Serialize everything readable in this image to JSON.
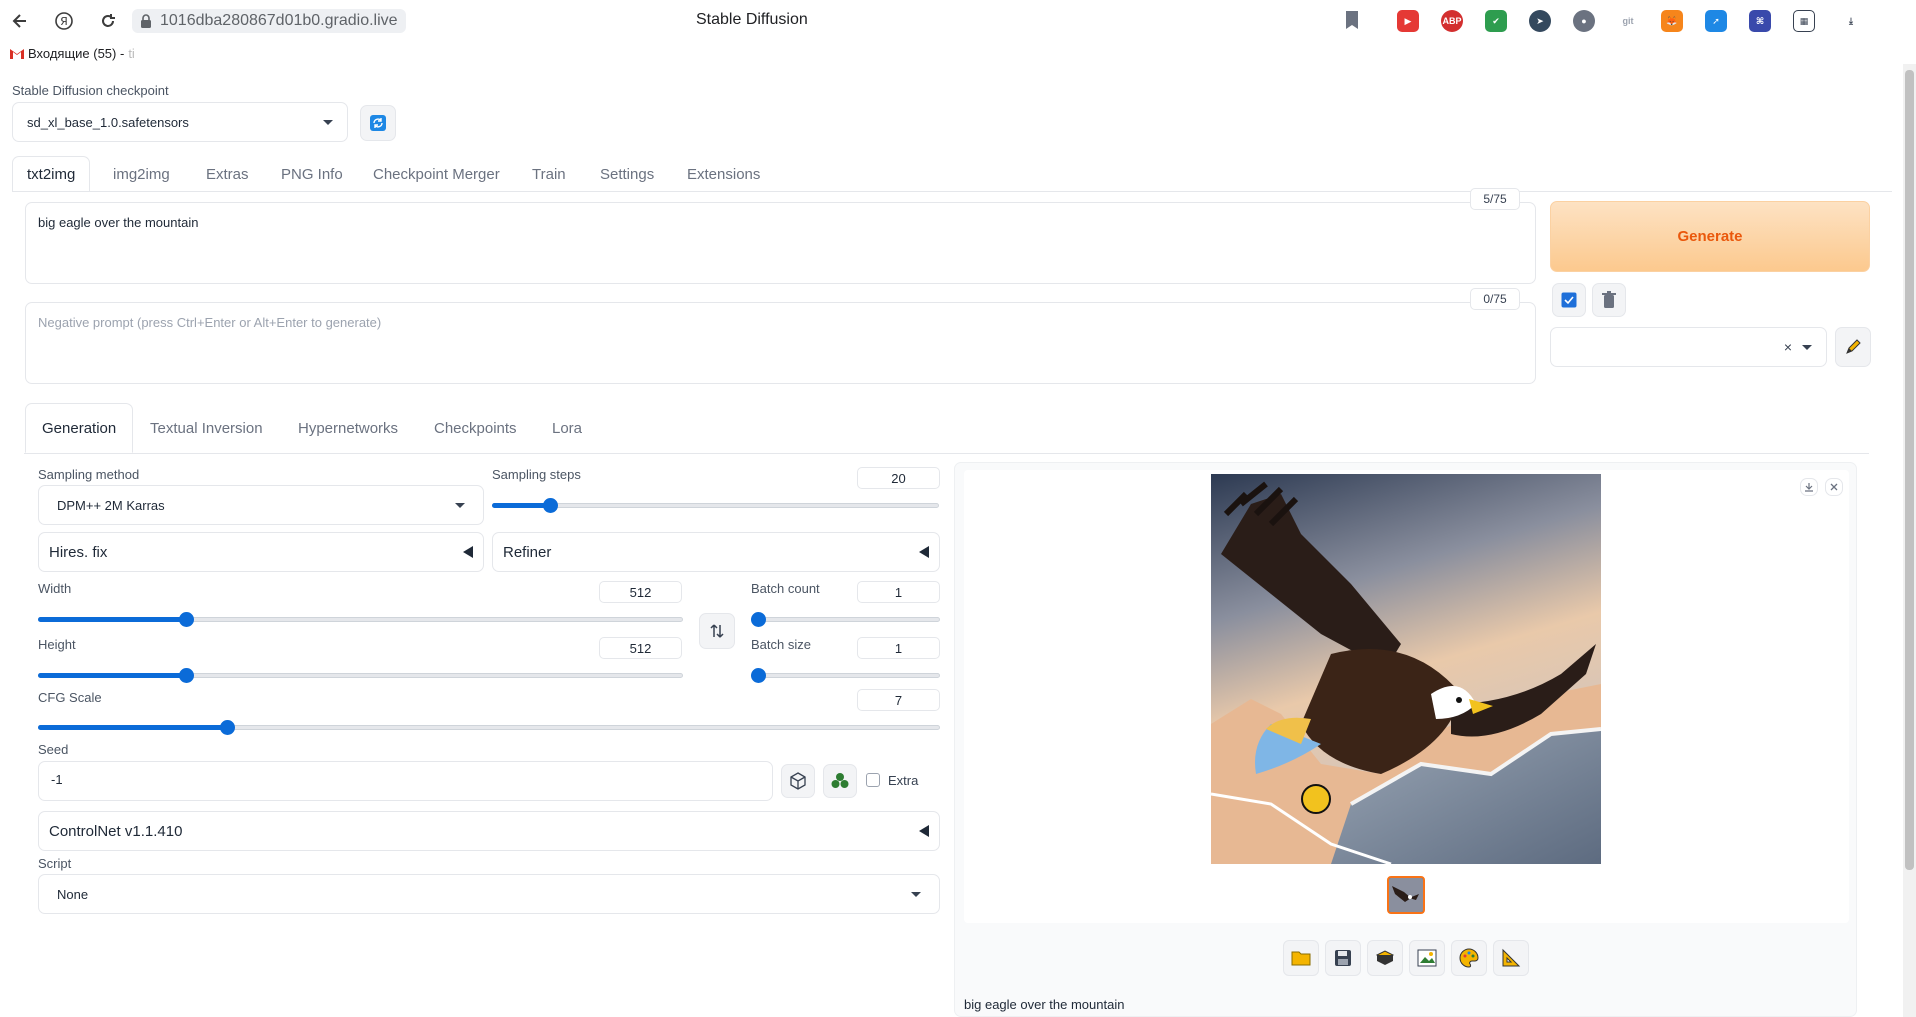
{
  "browser": {
    "url": "1016dba280867d01b0.gradio.live",
    "page_title": "Stable Diffusion",
    "bookmark": "Входящие (55) - ",
    "bookmark_tail": "ti",
    "extensions": [
      "youtube-icon",
      "abp-icon",
      "shield-icon",
      "cursor-icon",
      "planet-icon",
      "gitzip-icon",
      "metamask-icon",
      "send-icon",
      "scan-icon",
      "grid-icon",
      "download-icon"
    ]
  },
  "checkpoint": {
    "label": "Stable Diffusion checkpoint",
    "value": "sd_xl_base_1.0.safetensors"
  },
  "main_tabs": [
    "txt2img",
    "img2img",
    "Extras",
    "PNG Info",
    "Checkpoint Merger",
    "Train",
    "Settings",
    "Extensions"
  ],
  "prompt": {
    "value": "big eagle over the mountain",
    "token_count": "5/75"
  },
  "negative_prompt": {
    "placeholder": "Negative prompt (press Ctrl+Enter or Alt+Enter to generate)",
    "token_count": "0/75"
  },
  "generate_label": "Generate",
  "style_clear": "×",
  "sub_tabs": [
    "Generation",
    "Textual Inversion",
    "Hypernetworks",
    "Checkpoints",
    "Lora"
  ],
  "sampling": {
    "method_label": "Sampling method",
    "method_value": "DPM++ 2M Karras",
    "steps_label": "Sampling steps",
    "steps_value": "20",
    "steps_fraction": 0.13
  },
  "hires_label": "Hires. fix",
  "refiner_label": "Refiner",
  "width": {
    "label": "Width",
    "value": "512",
    "fraction": 0.23
  },
  "height": {
    "label": "Height",
    "value": "512",
    "fraction": 0.23
  },
  "batch_count": {
    "label": "Batch count",
    "value": "1",
    "fraction": 0.0
  },
  "batch_size": {
    "label": "Batch size",
    "value": "1",
    "fraction": 0.0
  },
  "cfg": {
    "label": "CFG Scale",
    "value": "7",
    "fraction": 0.21
  },
  "seed": {
    "label": "Seed",
    "value": "-1",
    "extra_label": "Extra"
  },
  "controlnet_label": "ControlNet v1.1.410",
  "script": {
    "label": "Script",
    "value": "None"
  },
  "output_caption": "big eagle over the mountain",
  "colors": {
    "accent": "#0b6bd8",
    "generate_text": "#ea580c",
    "generate_bg": "#fcc98e"
  }
}
